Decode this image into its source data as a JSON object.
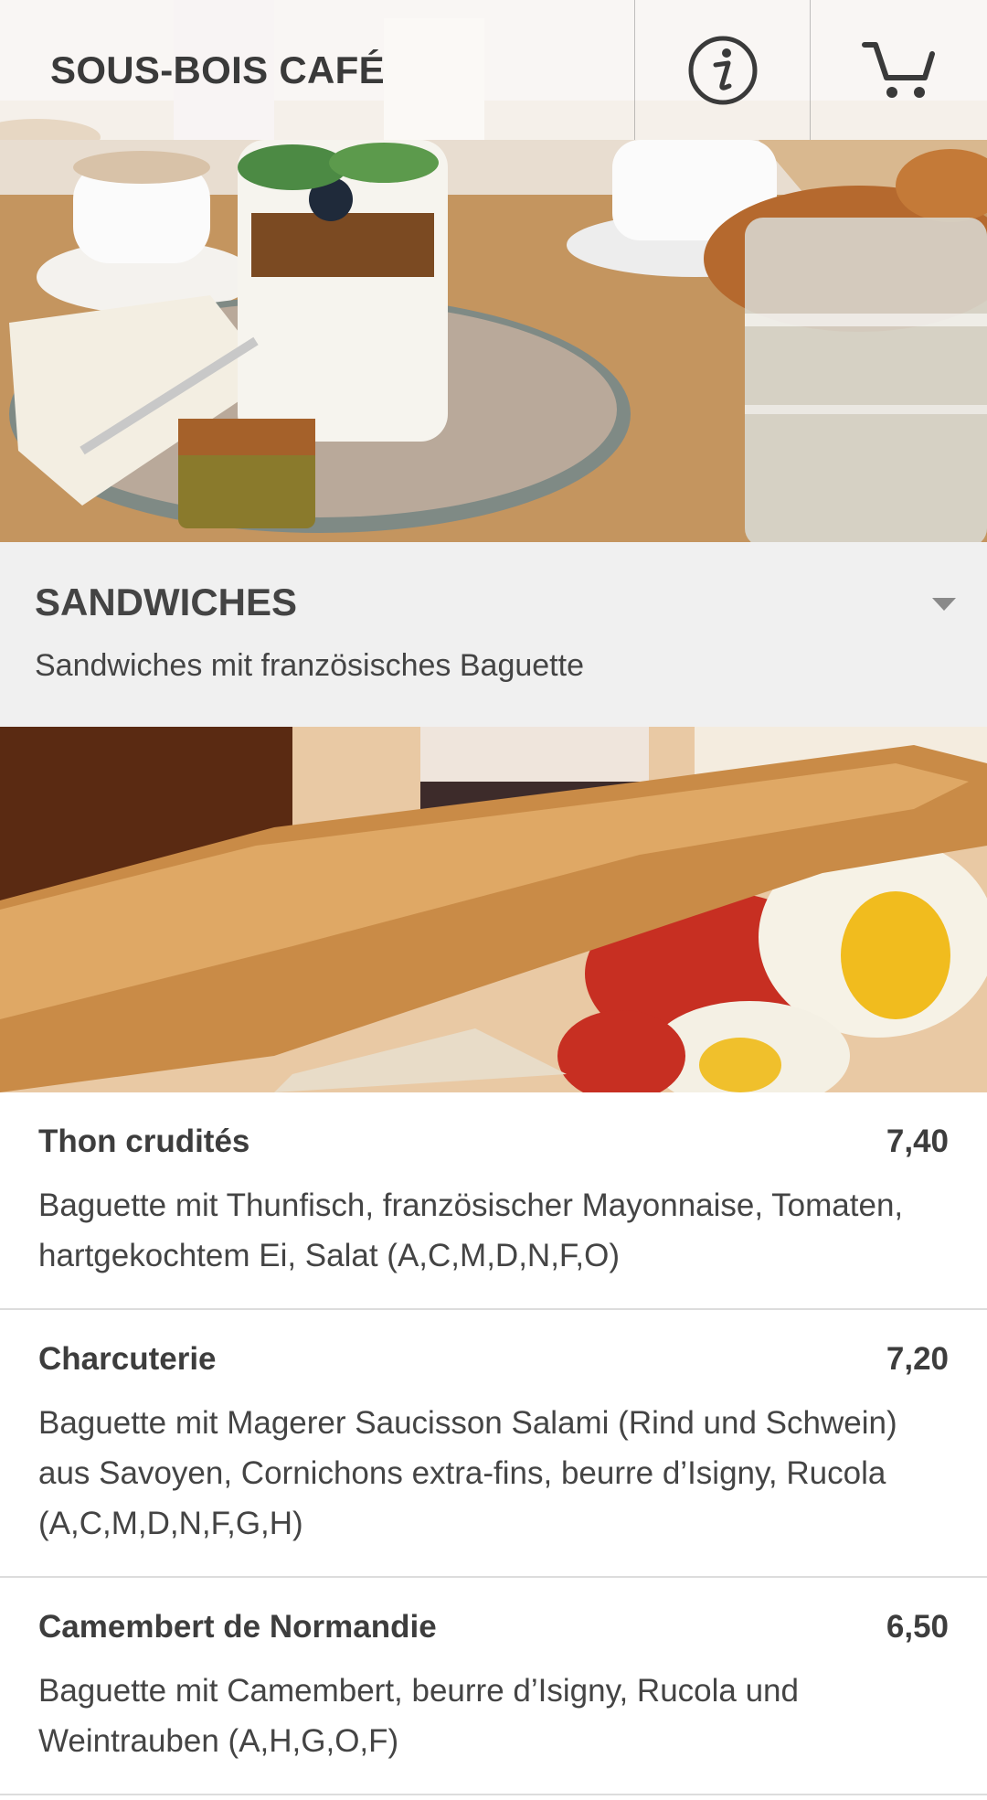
{
  "header": {
    "brand": "SOUS-BOIS CAFÉ",
    "info_icon": "info-icon",
    "cart_icon": "cart-icon"
  },
  "category": {
    "title": "SANDWICHES",
    "description": "Sandwiches mit französisches Baguette",
    "toggle_icon": "caret-down-icon"
  },
  "items": [
    {
      "name": "Thon crudités",
      "price": "7,40",
      "description": "Baguette mit Thunfisch, französischer Mayonnaise, Tomaten, hartgekochtem Ei, Salat (A,C,M,D,N,F,O)"
    },
    {
      "name": "Charcuterie",
      "price": "7,20",
      "description": "Baguette mit Magerer Saucisson Salami (Rind und Schwein) aus Savoyen, Cornichons extra-fins, beurre d’Isigny, Rucola (A,C,M,D,N,F,G,H)"
    },
    {
      "name": "Camembert de Normandie",
      "price": "6,50",
      "description": "Baguette mit Camembert, beurre d’Isigny, Rucola und Weintrauben (A,H,G,O,F)"
    }
  ],
  "colors": {
    "text": "#3d3d3d",
    "category_bg": "#f0f0f0",
    "divider": "#dcdcdc"
  }
}
